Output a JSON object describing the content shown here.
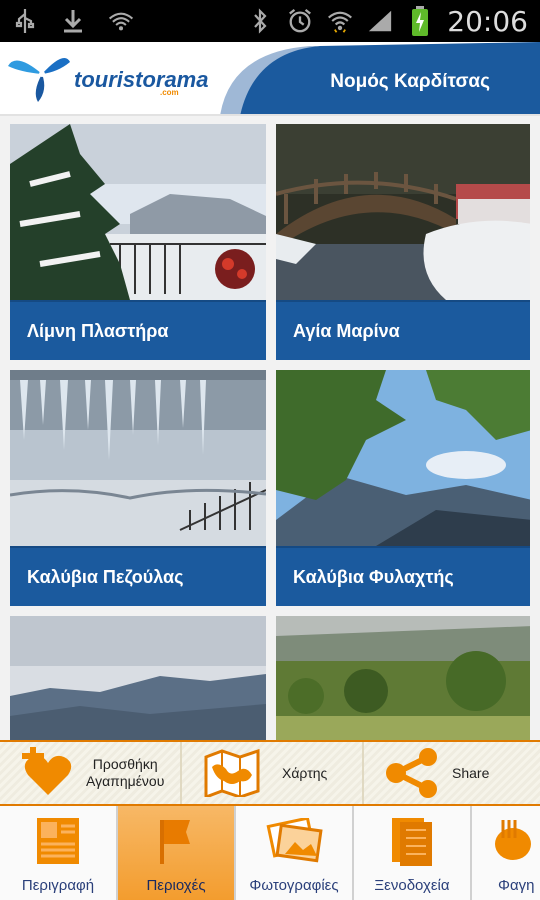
{
  "status_bar": {
    "time": "20:06",
    "left_icons": [
      "usb-icon",
      "download-icon",
      "wifi-question-icon"
    ],
    "right_icons": [
      "bluetooth-icon",
      "alarm-clock-icon",
      "wifi-icon",
      "signal-icon",
      "battery-charging-icon"
    ]
  },
  "header": {
    "logo_text": "touristorama",
    "logo_suffix": ".com",
    "title": "Νομός Καρδίτσας",
    "brand_color": "#1b5a9e"
  },
  "places": [
    {
      "label": "Λίμνη Πλαστήρα",
      "scene": "snowy-fir-lake"
    },
    {
      "label": "Αγία Μαρίνα",
      "scene": "snowy-bridge-river"
    },
    {
      "label": "Καλύβια Πεζούλας",
      "scene": "icicles-snow"
    },
    {
      "label": "Καλύβια Φυλαχτής",
      "scene": "trees-mountains-sky"
    },
    {
      "label": "",
      "scene": "misty-mountains"
    },
    {
      "label": "",
      "scene": "green-meadow"
    }
  ],
  "actions": [
    {
      "label_line1": "Προσθήκη",
      "label_line2": "Αγαπημένου",
      "icon": "add-favorite-heart-icon"
    },
    {
      "label_line1": "Χάρτης",
      "label_line2": "",
      "icon": "map-icon"
    },
    {
      "label_line1": "Share",
      "label_line2": "",
      "icon": "share-icon"
    }
  ],
  "tabs": [
    {
      "label": "Περιγραφή",
      "icon": "description-icon",
      "active": false
    },
    {
      "label": "Περιοχές",
      "icon": "flag-icon",
      "active": true
    },
    {
      "label": "Φωτογραφίες",
      "icon": "photos-icon",
      "active": false
    },
    {
      "label": "Ξενοδοχεία",
      "icon": "hotels-icon",
      "active": false
    },
    {
      "label": "Φαγη",
      "icon": "food-icon",
      "active": false
    }
  ],
  "accent_color": "#f08a00"
}
